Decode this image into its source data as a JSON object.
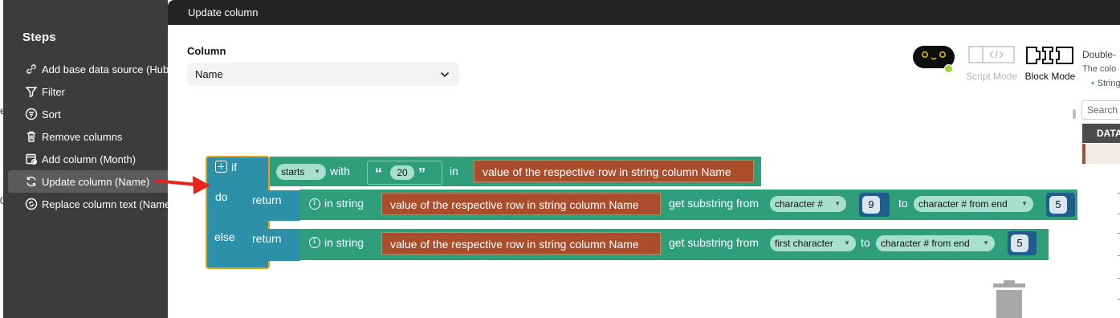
{
  "sidebar": {
    "title": "Steps",
    "items": [
      {
        "label": "Add base data source (Hub_",
        "icon": "link-icon"
      },
      {
        "label": "Filter",
        "icon": "filter-icon"
      },
      {
        "label": "Sort",
        "icon": "sort-icon"
      },
      {
        "label": "Remove columns",
        "icon": "trash-icon"
      },
      {
        "label": "Add column (Month)",
        "icon": "add-column-icon"
      },
      {
        "label": "Update column (Name)",
        "icon": "refresh-icon",
        "active": true
      },
      {
        "label": "Replace column text (Name)",
        "icon": "replace-icon"
      }
    ]
  },
  "dialog": {
    "title": "Update column",
    "column_label": "Column",
    "column_value": "Name",
    "modes": {
      "script": "Script Mode",
      "block": "Block Mode",
      "active": "block"
    },
    "help_title": "Double-",
    "help_sub": "The colo",
    "help_bullet": "String",
    "search_placeholder": "Search",
    "data_header": "DATA"
  },
  "blocks": {
    "if_label": "if",
    "do_label": "do",
    "else_label": "else",
    "condition": {
      "op": "starts",
      "with": "with",
      "string": "20",
      "open_quote": "“",
      "close_quote": "”",
      "in": "in",
      "value": "value of the respective row in string column Name"
    },
    "do_row": {
      "return": "return",
      "in_string": "in string",
      "value": "value of the respective row in string column Name",
      "get_substring": "get substring from",
      "from_mode": "character #",
      "from_num": "9",
      "to": "to",
      "to_mode": "character # from end",
      "to_num": "5"
    },
    "else_row": {
      "return": "return",
      "in_string": "in string",
      "value": "value of the respective row in string column Name",
      "get_substring": "get substring from",
      "from_mode": "first character",
      "to": "to",
      "to_mode": "character # from end",
      "to_num": "5"
    }
  },
  "colors": {
    "sidebar_bg": "#3c3c3c",
    "header_bg": "#242424",
    "logic_block": "#2b90a8",
    "text_block": "#2f9e7a",
    "value_block": "#a94d2b",
    "number_block": "#1f5d8e",
    "highlight": "#f39c12",
    "annotation_arrow": "#e8231c"
  }
}
